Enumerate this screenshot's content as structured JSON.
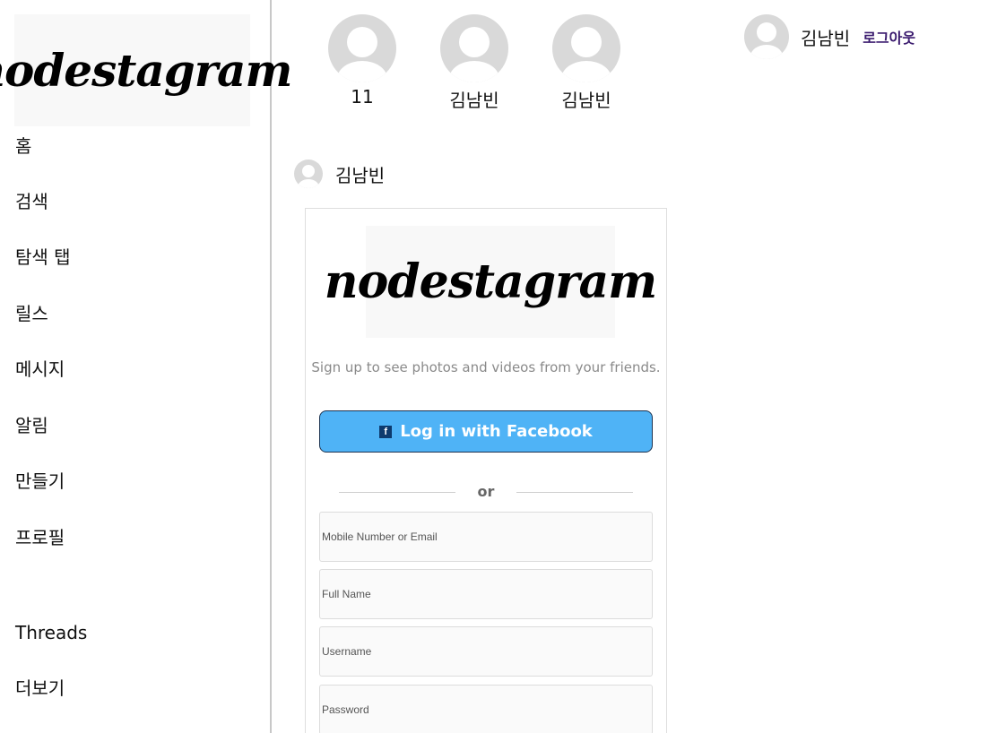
{
  "brand": {
    "logo_text": "nodestagram"
  },
  "sidebar": {
    "items": [
      {
        "label": "홈",
        "name": "home"
      },
      {
        "label": "검색",
        "name": "search"
      },
      {
        "label": "탐색 탭",
        "name": "explore"
      },
      {
        "label": "릴스",
        "name": "reels"
      },
      {
        "label": "메시지",
        "name": "messages"
      },
      {
        "label": "알림",
        "name": "notifications"
      },
      {
        "label": "만들기",
        "name": "create"
      },
      {
        "label": "프로필",
        "name": "profile"
      },
      {
        "label": "Threads",
        "name": "threads"
      },
      {
        "label": "더보기",
        "name": "more"
      }
    ]
  },
  "stories": [
    {
      "name": "11"
    },
    {
      "name": "김남빈"
    },
    {
      "name": "김남빈"
    }
  ],
  "top_user": {
    "name": "김남빈",
    "logout_label": "로그아웃"
  },
  "post": {
    "author": "김남빈",
    "card": {
      "tagline": "Sign up to see photos and videos from your friends.",
      "facebook_icon": "f",
      "facebook_button": "Log in with Facebook",
      "or_text": "or",
      "fields": [
        {
          "placeholder": "Mobile Number or Email"
        },
        {
          "placeholder": "Full Name"
        },
        {
          "placeholder": "Username"
        },
        {
          "placeholder": "Password"
        }
      ]
    }
  },
  "colors": {
    "facebook_button": "#4fb3f6",
    "logout_link": "#3a1a6e",
    "avatar_bg": "#d9d9d9"
  }
}
